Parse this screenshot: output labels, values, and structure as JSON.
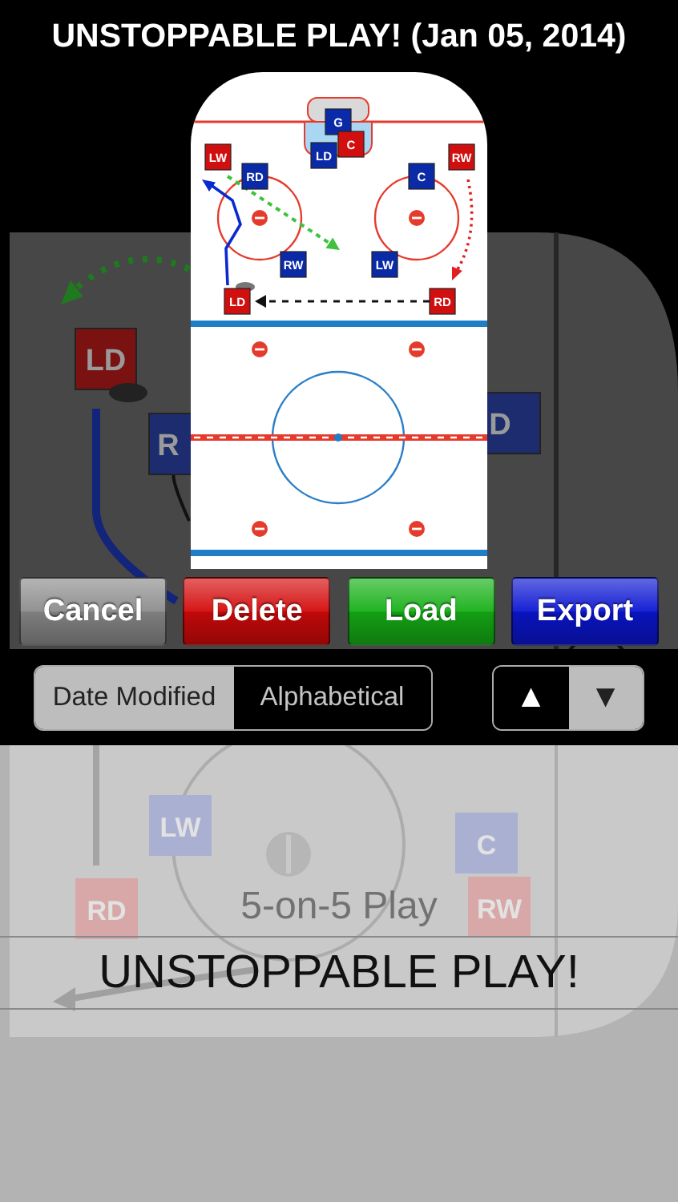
{
  "title": "UNSTOPPABLE PLAY! (Jan 05, 2014)",
  "background_rink": {
    "tokens": [
      {
        "label": "LD",
        "color": "#7a1212"
      },
      {
        "label": "R",
        "color": "#1c2c6e"
      },
      {
        "label": "D",
        "color": "#1c2c6e"
      }
    ]
  },
  "preview": {
    "players": [
      {
        "label": "G",
        "color": "#0a2aa8"
      },
      {
        "label": "LW",
        "color": "#d10f0f"
      },
      {
        "label": "LD",
        "color": "#0a2aa8"
      },
      {
        "label": "C",
        "color": "#d10f0f"
      },
      {
        "label": "RW",
        "color": "#d10f0f"
      },
      {
        "label": "RD",
        "color": "#0a2aa8"
      },
      {
        "label": "C",
        "color": "#0a2aa8"
      },
      {
        "label": "RW",
        "color": "#0a2aa8"
      },
      {
        "label": "LW",
        "color": "#0a2aa8"
      },
      {
        "label": "LD",
        "color": "#d10f0f"
      },
      {
        "label": "RD",
        "color": "#d10f0f"
      }
    ]
  },
  "buttons": [
    {
      "label": "Cancel",
      "color": "#8c8c8c"
    },
    {
      "label": "Delete",
      "color": "#d40a0a"
    },
    {
      "label": "Load",
      "color": "#16b016"
    },
    {
      "label": "Export",
      "color": "#0b16d2"
    }
  ],
  "sort": {
    "options": [
      {
        "label": "Date Modified",
        "selected": true
      },
      {
        "label": "Alphabetical",
        "selected": false
      }
    ],
    "direction": [
      {
        "symbol": "▲",
        "selected": false
      },
      {
        "symbol": "▼",
        "selected": true
      }
    ]
  },
  "picker": {
    "tokens": [
      {
        "label": "LW",
        "color": "#aab0d2"
      },
      {
        "label": "C",
        "color": "#aab0d2"
      },
      {
        "label": "RD",
        "color": "#d8a8a8"
      },
      {
        "label": "RW",
        "color": "#d8a8a8"
      }
    ],
    "items": [
      {
        "label": "5-on-5 Play",
        "selected": false
      },
      {
        "label": "UNSTOPPABLE PLAY!",
        "selected": true
      }
    ]
  }
}
